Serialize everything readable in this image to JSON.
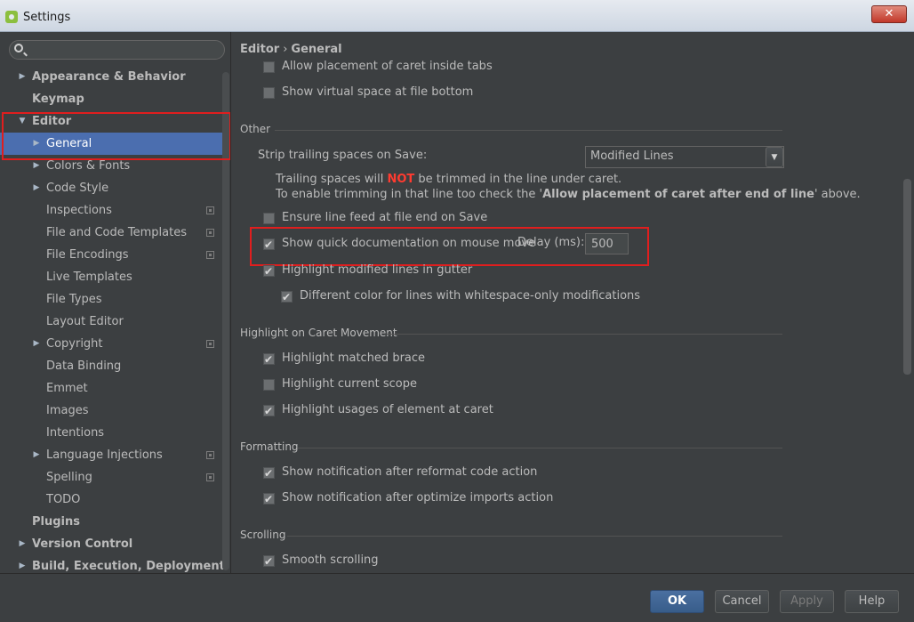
{
  "window": {
    "title": "Settings",
    "close_label": "✕"
  },
  "search": {
    "value": "",
    "placeholder": ""
  },
  "tree": [
    {
      "label": "Appearance & Behavior",
      "bold": true,
      "level": 0,
      "arrow": "▶",
      "proj": false
    },
    {
      "label": "Keymap",
      "bold": true,
      "level": 0,
      "arrow": "",
      "proj": false
    },
    {
      "label": "Editor",
      "bold": true,
      "level": 0,
      "arrow": "▼",
      "proj": false
    },
    {
      "label": "General",
      "bold": false,
      "level": 1,
      "arrow": "▶",
      "proj": false,
      "selected": true
    },
    {
      "label": "Colors & Fonts",
      "bold": false,
      "level": 1,
      "arrow": "▶",
      "proj": false
    },
    {
      "label": "Code Style",
      "bold": false,
      "level": 1,
      "arrow": "▶",
      "proj": false
    },
    {
      "label": "Inspections",
      "bold": false,
      "level": 1,
      "arrow": "",
      "proj": true
    },
    {
      "label": "File and Code Templates",
      "bold": false,
      "level": 1,
      "arrow": "",
      "proj": true
    },
    {
      "label": "File Encodings",
      "bold": false,
      "level": 1,
      "arrow": "",
      "proj": true
    },
    {
      "label": "Live Templates",
      "bold": false,
      "level": 1,
      "arrow": "",
      "proj": false
    },
    {
      "label": "File Types",
      "bold": false,
      "level": 1,
      "arrow": "",
      "proj": false
    },
    {
      "label": "Layout Editor",
      "bold": false,
      "level": 1,
      "arrow": "",
      "proj": false
    },
    {
      "label": "Copyright",
      "bold": false,
      "level": 1,
      "arrow": "▶",
      "proj": true
    },
    {
      "label": "Data Binding",
      "bold": false,
      "level": 1,
      "arrow": "",
      "proj": false
    },
    {
      "label": "Emmet",
      "bold": false,
      "level": 1,
      "arrow": "",
      "proj": false
    },
    {
      "label": "Images",
      "bold": false,
      "level": 1,
      "arrow": "",
      "proj": false
    },
    {
      "label": "Intentions",
      "bold": false,
      "level": 1,
      "arrow": "",
      "proj": false
    },
    {
      "label": "Language Injections",
      "bold": false,
      "level": 1,
      "arrow": "▶",
      "proj": true
    },
    {
      "label": "Spelling",
      "bold": false,
      "level": 1,
      "arrow": "",
      "proj": true
    },
    {
      "label": "TODO",
      "bold": false,
      "level": 1,
      "arrow": "",
      "proj": false
    },
    {
      "label": "Plugins",
      "bold": true,
      "level": 0,
      "arrow": "",
      "proj": false
    },
    {
      "label": "Version Control",
      "bold": true,
      "level": 0,
      "arrow": "▶",
      "proj": false
    },
    {
      "label": "Build, Execution, Deployment",
      "bold": true,
      "level": 0,
      "arrow": "▶",
      "proj": false
    }
  ],
  "breadcrumb": {
    "parent": "Editor",
    "separator": "›",
    "current": "General"
  },
  "options": {
    "allow_caret_tabs": {
      "label": "Allow placement of caret inside tabs",
      "checked": false
    },
    "virtual_space_bottom": {
      "label": "Show virtual space at file bottom",
      "checked": false
    },
    "ensure_line_feed": {
      "label": "Ensure line feed at file end on Save",
      "checked": false
    },
    "quick_doc": {
      "label": "Show quick documentation on mouse move",
      "checked": true
    },
    "highlight_modified": {
      "label": "Highlight modified lines in gutter",
      "checked": true
    },
    "different_color": {
      "label": "Different color for lines with whitespace-only modifications",
      "checked": true
    },
    "highlight_brace": {
      "label": "Highlight matched brace",
      "checked": true
    },
    "highlight_scope": {
      "label": "Highlight current scope",
      "checked": false
    },
    "highlight_usages": {
      "label": "Highlight usages of element at caret",
      "checked": true
    },
    "notify_reformat": {
      "label": "Show notification after reformat code action",
      "checked": true
    },
    "notify_imports": {
      "label": "Show notification after optimize imports action",
      "checked": true
    },
    "smooth_scrolling": {
      "label": "Smooth scrolling",
      "checked": true
    }
  },
  "sections": {
    "other": "Other",
    "caret": "Highlight on Caret Movement",
    "formatting": "Formatting",
    "scrolling": "Scrolling"
  },
  "strip": {
    "label": "Strip trailing spaces on Save:",
    "selected": "Modified Lines",
    "note1_a": "Trailing spaces will ",
    "note1_b": "NOT",
    "note1_c": " be trimmed in the line under caret.",
    "note2_a": "To enable trimming in that line too check the '",
    "note2_b": "Allow placement of caret after end of line",
    "note2_c": "' above."
  },
  "delay": {
    "label": "Delay (ms):",
    "value": "500"
  },
  "buttons": {
    "ok": "OK",
    "cancel": "Cancel",
    "apply": "Apply",
    "help": "Help"
  },
  "colors": {
    "selection": "#4b6eaf",
    "highlight_box": "#e01e1e",
    "warning": "#ff3b30"
  }
}
